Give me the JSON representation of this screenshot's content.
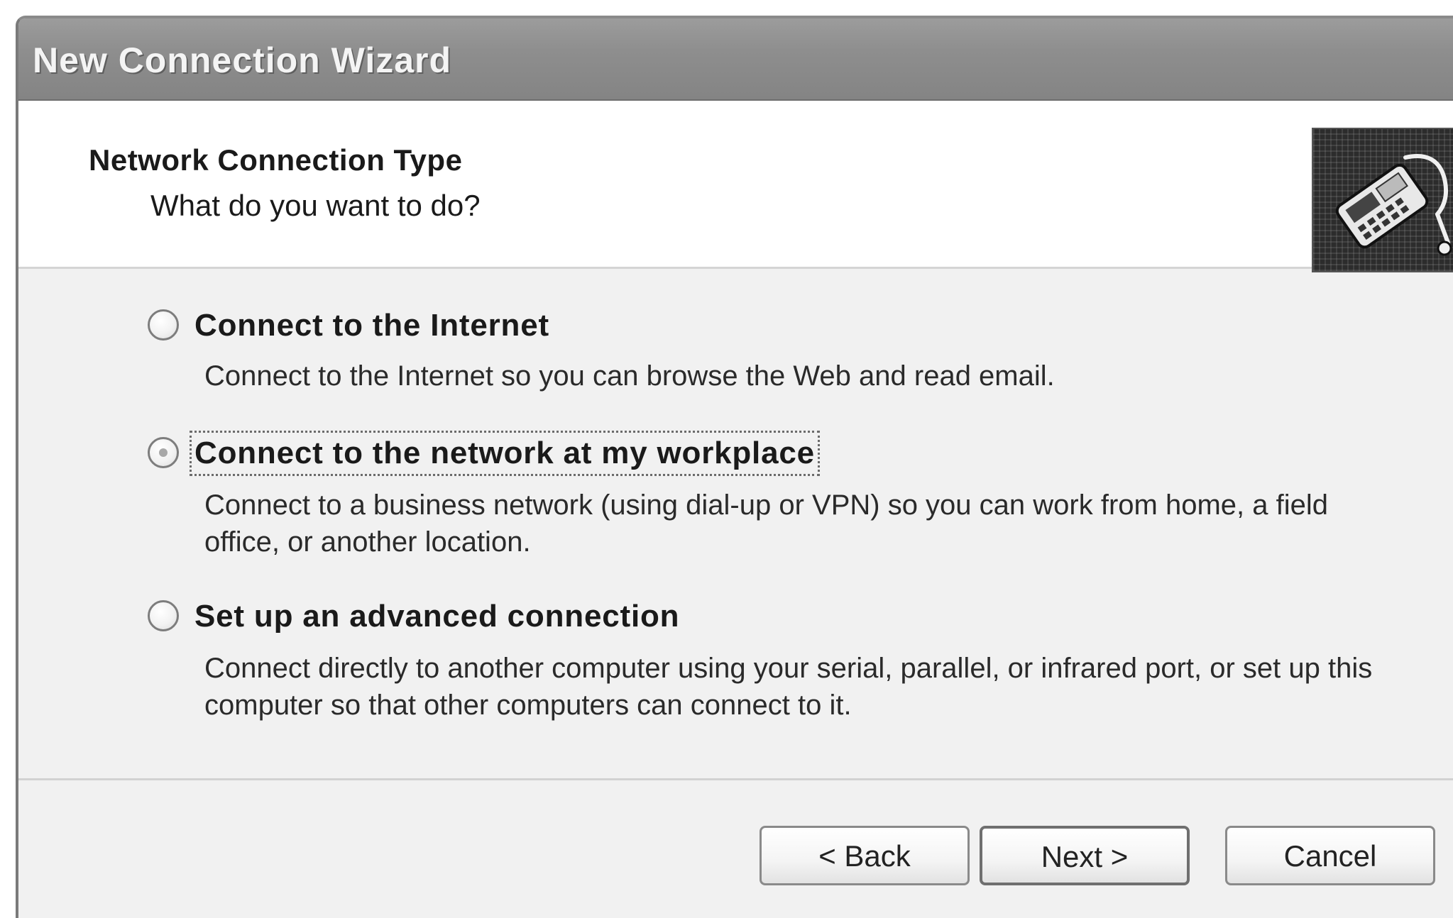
{
  "window": {
    "title": "New Connection Wizard"
  },
  "header": {
    "title": "Network Connection Type",
    "subtitle": "What do you want to do?",
    "icon": "network-connection-icon"
  },
  "options": [
    {
      "label": "Connect to the Internet",
      "description": "Connect to the Internet so you can browse the Web and read email.",
      "selected": false
    },
    {
      "label": "Connect to the network at my workplace",
      "description": "Connect to a business network (using dial-up or VPN) so you can work from home, a field office, or another location.",
      "selected": true
    },
    {
      "label": "Set up an advanced connection",
      "description": "Connect directly to another computer using your serial, parallel, or infrared port, or set up this computer so that other computers can connect to it.",
      "selected": false
    }
  ],
  "buttons": {
    "back": "< Back",
    "next": "Next >",
    "cancel": "Cancel"
  }
}
